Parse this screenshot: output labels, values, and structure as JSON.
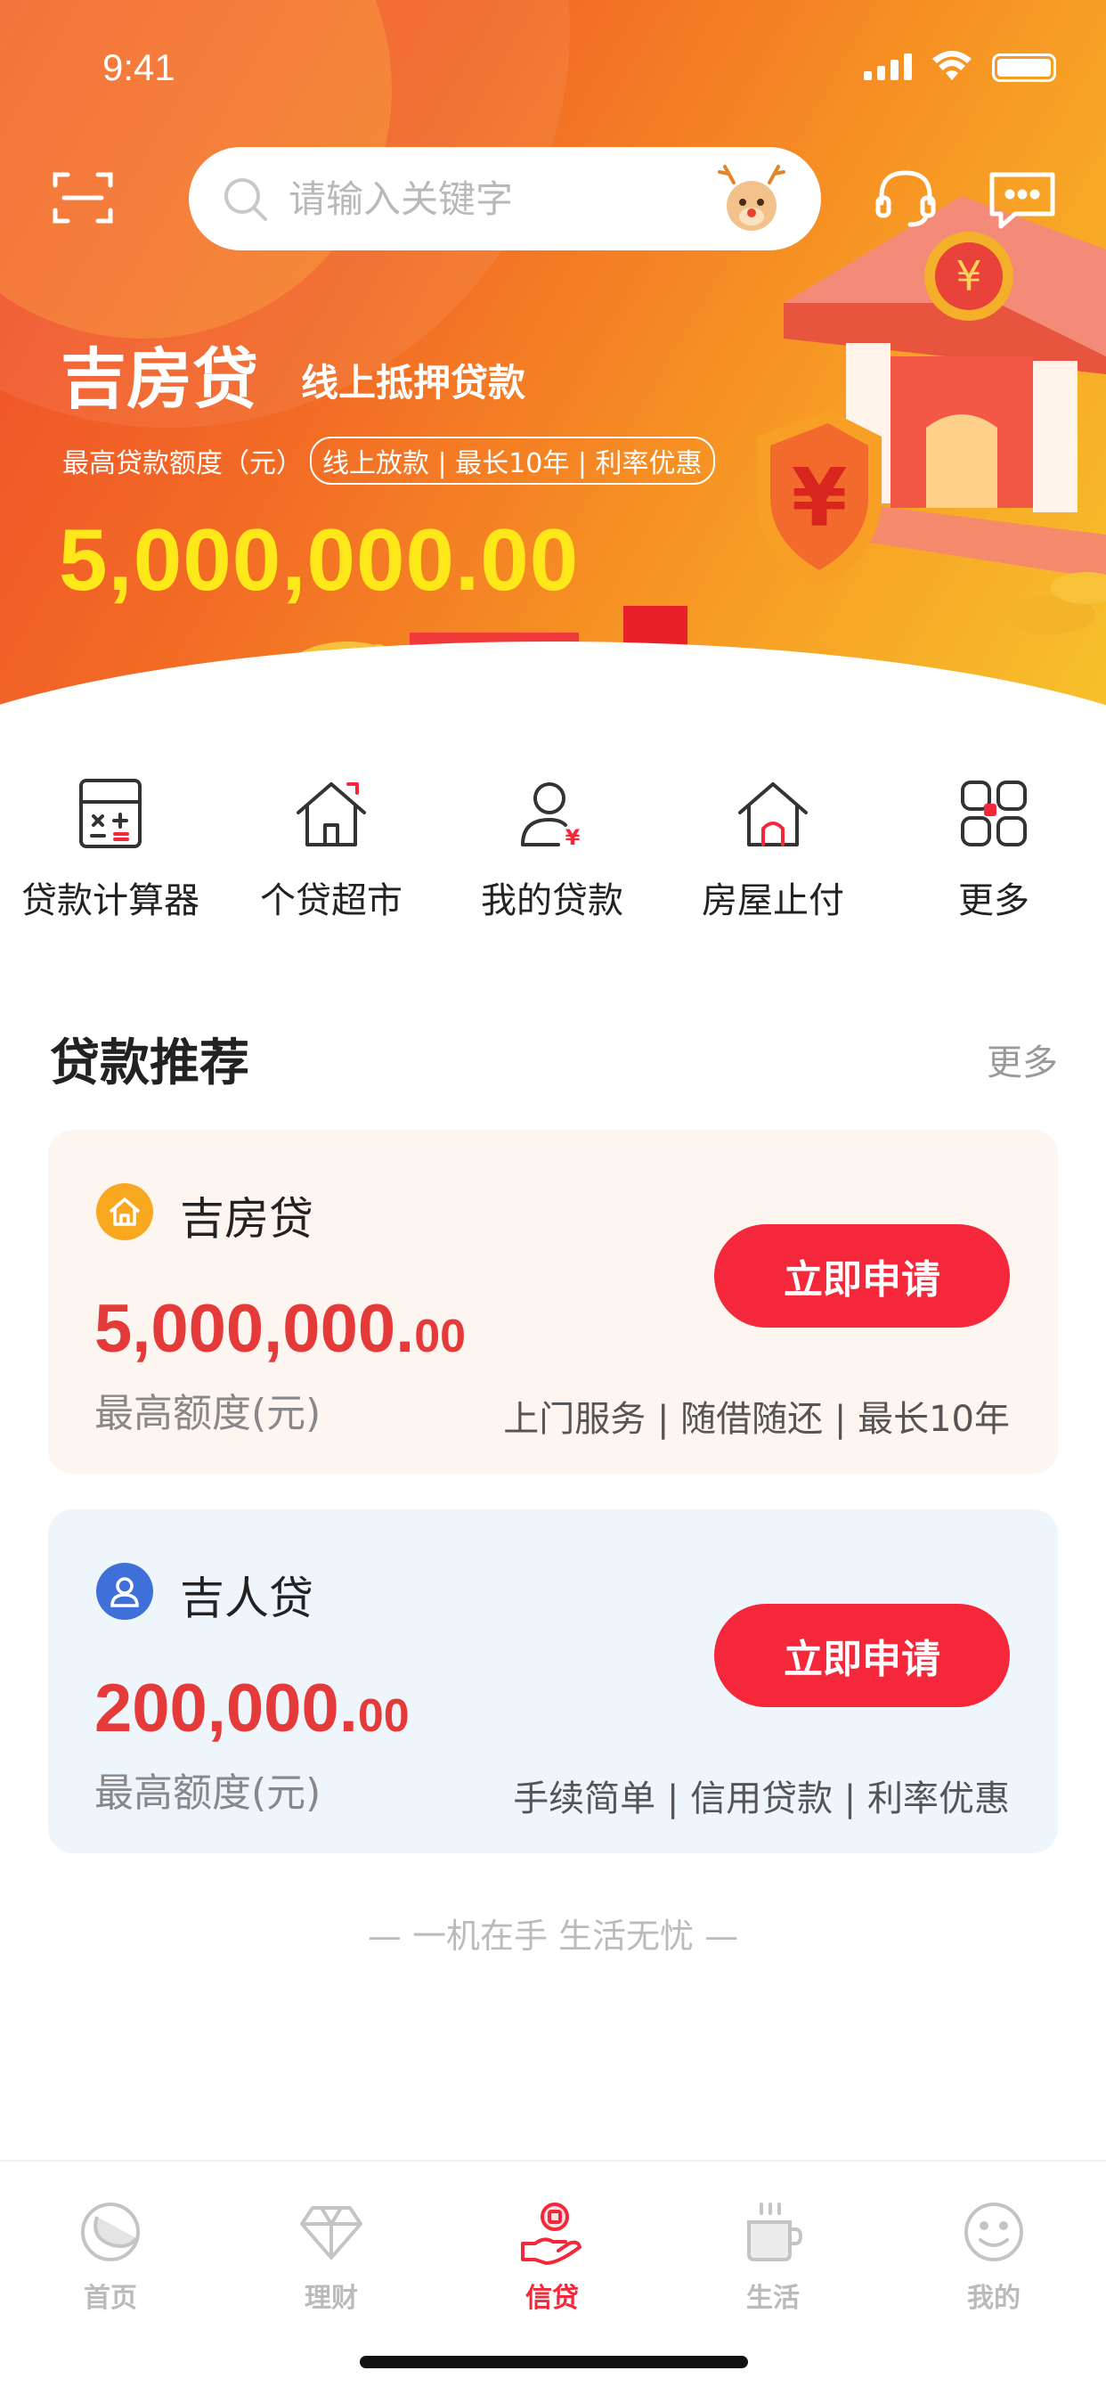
{
  "status_bar": {
    "time": "9:41"
  },
  "header": {
    "search_placeholder": "请输入关键字"
  },
  "hero": {
    "title": "吉房贷",
    "subtitle": "线上抵押贷款",
    "limit_label": "最高贷款额度（元）",
    "tags": "线上放款 | 最长10年 | 利率优惠",
    "amount": "5,000,000.00",
    "colors": {
      "gradient_start": "#ef4a2c",
      "gradient_end": "#f7c12b",
      "amount": "#ffe81a"
    }
  },
  "quick_nav": [
    {
      "label": "贷款计算器",
      "icon": "calculator-icon"
    },
    {
      "label": "个贷超市",
      "icon": "house-icon"
    },
    {
      "label": "我的贷款",
      "icon": "user-yuan-icon"
    },
    {
      "label": "房屋止付",
      "icon": "house-stop-icon"
    },
    {
      "label": "更多",
      "icon": "grid-icon"
    }
  ],
  "section": {
    "title": "贷款推荐",
    "more": "更多"
  },
  "products": [
    {
      "name": "吉房贷",
      "icon": "house-badge-icon",
      "amount_int": "5,000,000.",
      "amount_dec": "00",
      "caption": "最高额度(元)",
      "button": "立即申请",
      "features": "上门服务 | 随借随还 | 最长10年",
      "icon_color": "#f7a81e"
    },
    {
      "name": "吉人贷",
      "icon": "person-badge-icon",
      "amount_int": "200,000.",
      "amount_dec": "00",
      "caption": "最高额度(元)",
      "button": "立即申请",
      "features": "手续简单 | 信用贷款 | 利率优惠",
      "icon_color": "#3f6fd8"
    }
  ],
  "slogan": "— 一机在手 生活无忧 —",
  "tabs": [
    {
      "label": "首页",
      "icon": "moon-home-icon",
      "active": false
    },
    {
      "label": "理财",
      "icon": "diamond-icon",
      "active": false
    },
    {
      "label": "信贷",
      "icon": "hand-coin-icon",
      "active": true
    },
    {
      "label": "生活",
      "icon": "cup-icon",
      "active": false
    },
    {
      "label": "我的",
      "icon": "smile-icon",
      "active": false
    }
  ],
  "accent_color": "#f4283a"
}
